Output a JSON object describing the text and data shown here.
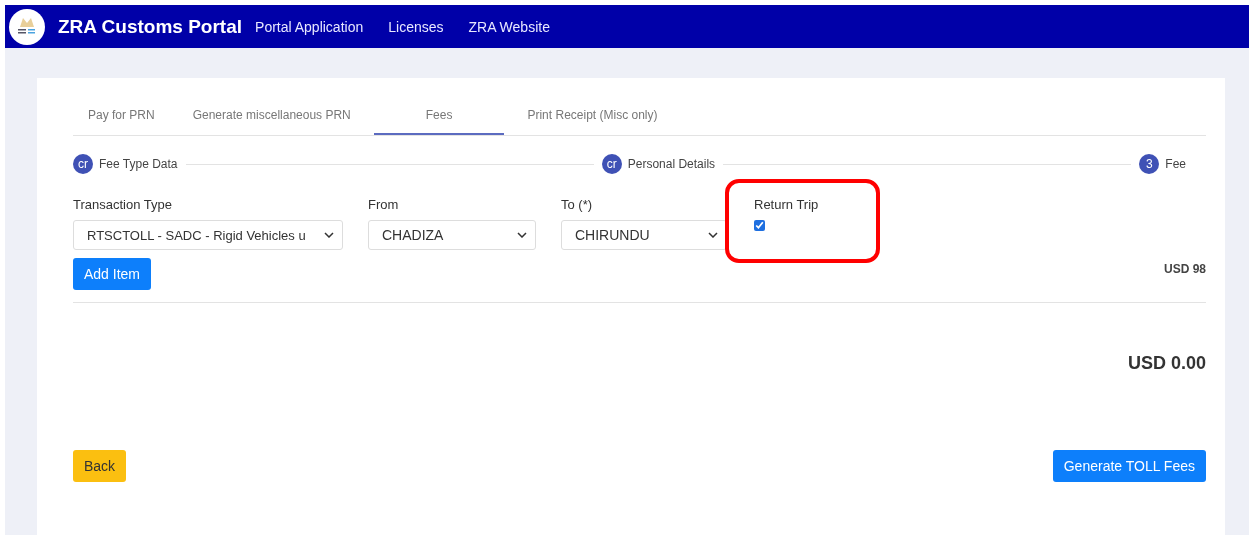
{
  "navbar": {
    "brand": "ZRA Customs Portal",
    "links": [
      "Portal Application",
      "Licenses",
      "ZRA Website"
    ]
  },
  "tabs": [
    {
      "label": "Pay for PRN",
      "selected": false
    },
    {
      "label": "Generate miscellaneous PRN",
      "selected": false
    },
    {
      "label": "Fees",
      "selected": true
    },
    {
      "label": "Print Receipt (Misc only)",
      "selected": false
    }
  ],
  "steps": [
    {
      "marker": "cr",
      "label": "Fee Type Data"
    },
    {
      "marker": "cr",
      "label": "Personal Details"
    },
    {
      "marker": "3",
      "label": "Fee"
    }
  ],
  "fields": [
    {
      "kind": "select",
      "label": "Transaction Type",
      "value": "RTSCTOLL - SADC - Rigid Vehicles u"
    },
    {
      "kind": "select",
      "label": "From",
      "value": "CHADIZA"
    },
    {
      "kind": "select",
      "label": "To (*)",
      "value": "CHIRUNDU"
    },
    {
      "kind": "checkbox",
      "label": "Return Trip",
      "checked": true,
      "highlighted": true
    }
  ],
  "add_button": "Add Item",
  "item_amount": "USD 98",
  "total": "USD 0.00",
  "back_button": "Back",
  "generate_button": "Generate TOLL Fees"
}
